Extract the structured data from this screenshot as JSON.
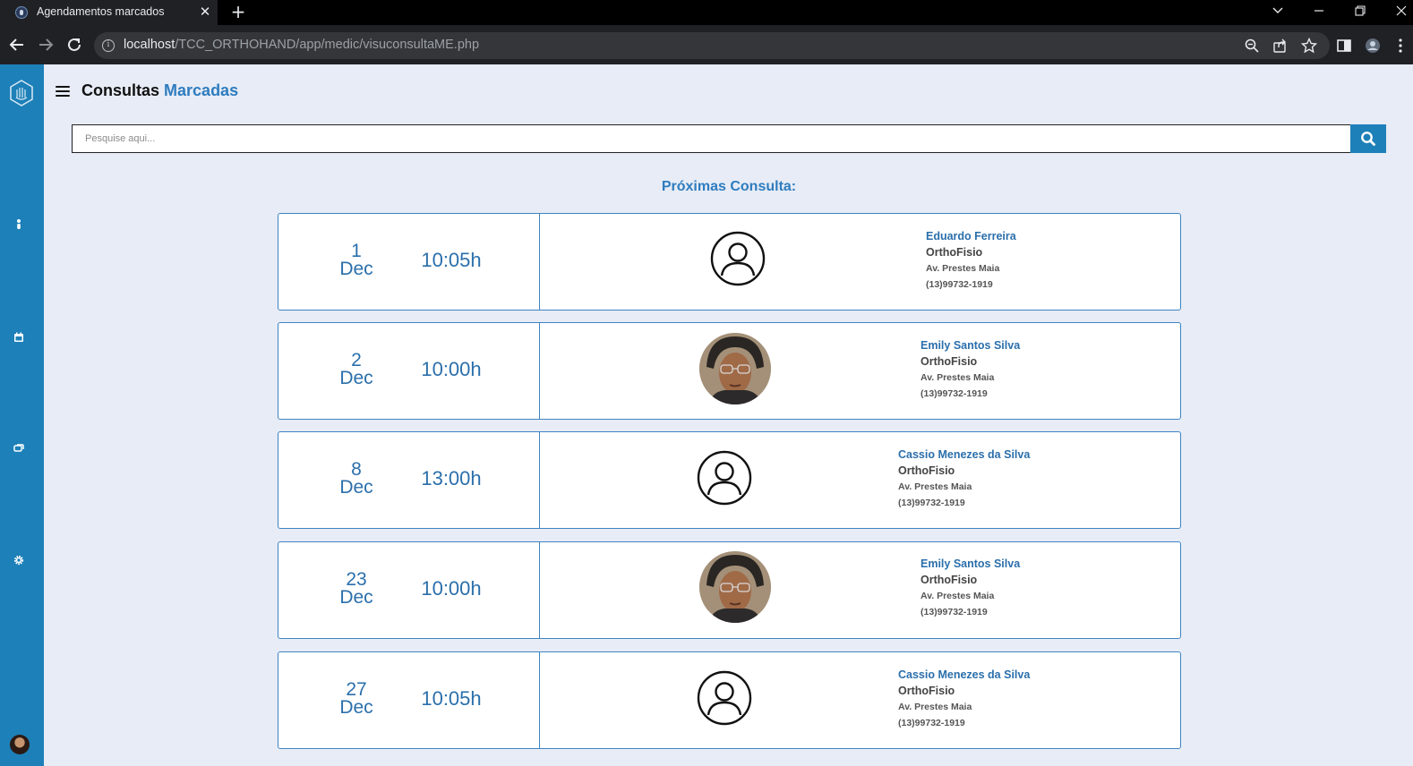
{
  "browser": {
    "tab_title": "Agendamentos marcados",
    "url_host": "localhost",
    "url_path": "/TCC_ORTHOHAND/app/medic/visuconsultaME.php"
  },
  "header": {
    "title_main": "Consultas",
    "title_accent": "Marcadas"
  },
  "search": {
    "placeholder": "Pesquise aqui..."
  },
  "section": {
    "title": "Próximas Consulta:"
  },
  "appointments": [
    {
      "day": "1",
      "month": "Dec",
      "time": "10:05h",
      "avatar": "default-user-icon",
      "name": "Eduardo Ferreira",
      "clinic": "OrthoFisio",
      "address": "Av. Prestes Maia",
      "phone": "(13)99732-1919"
    },
    {
      "day": "2",
      "month": "Dec",
      "time": "10:00h",
      "avatar": "photo",
      "name": "Emily Santos Silva",
      "clinic": "OrthoFisio",
      "address": "Av. Prestes Maia",
      "phone": "(13)99732-1919"
    },
    {
      "day": "8",
      "month": "Dec",
      "time": "13:00h",
      "avatar": "default-user-icon",
      "name": "Cassio Menezes da Silva",
      "clinic": "OrthoFisio",
      "address": "Av. Prestes Maia",
      "phone": "(13)99732-1919"
    },
    {
      "day": "23",
      "month": "Dec",
      "time": "10:00h",
      "avatar": "photo",
      "name": "Emily Santos Silva",
      "clinic": "OrthoFisio",
      "address": "Av. Prestes Maia",
      "phone": "(13)99732-1919"
    },
    {
      "day": "27",
      "month": "Dec",
      "time": "10:05h",
      "avatar": "default-user-icon",
      "name": "Cassio Menezes da Silva",
      "clinic": "OrthoFisio",
      "address": "Av. Prestes Maia",
      "phone": "(13)99732-1919"
    }
  ],
  "colors": {
    "sidebar": "#1d80b8",
    "accent": "#2e7cbf",
    "page_background": "#e7ecf6"
  }
}
